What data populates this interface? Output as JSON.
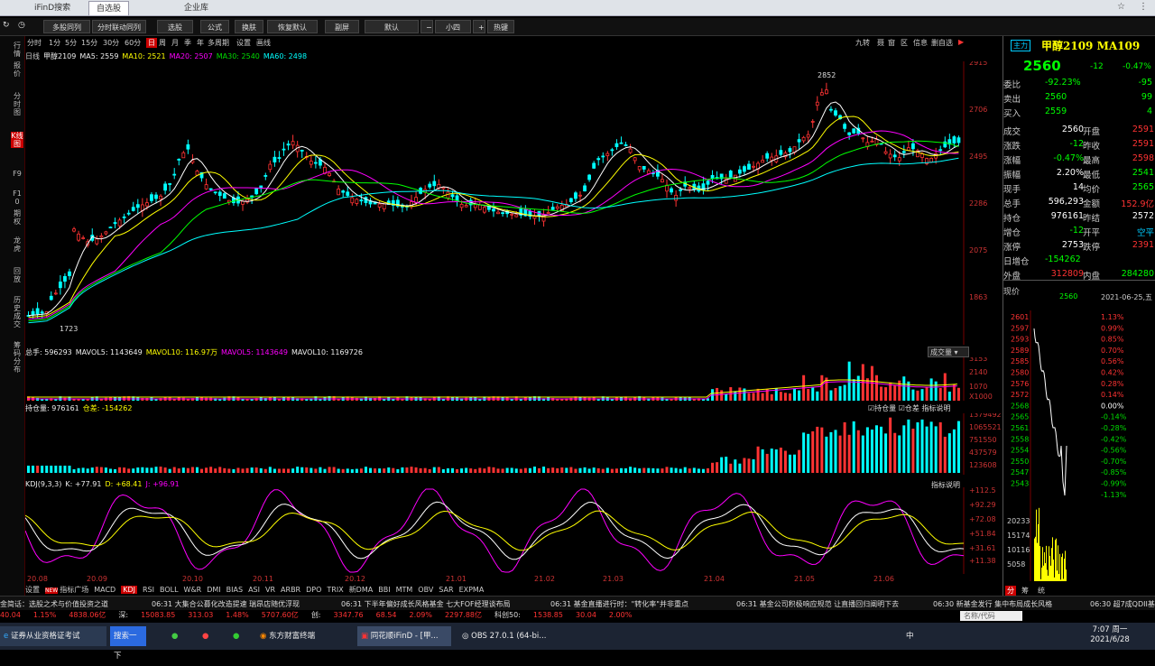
{
  "tabs": [
    "iFinD搜索",
    "自选股",
    "企业库"
  ],
  "toolbar": [
    "多股同列",
    "分时联动同列",
    "选股",
    "公式",
    "换肤",
    "恢复默认",
    "副屏",
    "默认",
    "小四",
    "热键"
  ],
  "left_nav": [
    "行情",
    "报价",
    "分时图",
    "K线图",
    "F9",
    "F10",
    "期权",
    "龙虎",
    "回放",
    "历史成交",
    "筹码分布"
  ],
  "periods": [
    "分时",
    "1分",
    "5分",
    "15分",
    "30分",
    "60分",
    "日",
    "周",
    "月",
    "季",
    "年",
    "多周期",
    "设置",
    "画线"
  ],
  "right_tools": [
    "九转",
    "聂",
    "窗",
    "区",
    "信息",
    "删自选"
  ],
  "ma_line": {
    "label": "日线",
    "name": "甲醇2109",
    "ma5": "MA5: 2559",
    "ma10": "MA10: 2521",
    "ma20": "MA20: 2507",
    "ma30": "MA30: 2540",
    "ma60": "MA60: 2498"
  },
  "price_axis": [
    "2915",
    "2706",
    "2495",
    "2286",
    "2075",
    "1863"
  ],
  "annot": {
    "high": "2852",
    "low": "1723"
  },
  "vol_line": {
    "a": "总手: 596293",
    "b": "MAVOL5: 1143649",
    "c": "MAVOL10: 116.97万",
    "d": "MAVOL5: 1143649",
    "e": "MAVOL10: 1169726"
  },
  "vol_axis": [
    "3153",
    "2140",
    "1070",
    "X1000"
  ],
  "vol_dropdown": "成交量",
  "oi_line": {
    "a": "持仓量: 976161",
    "b": "仓差: -154262"
  },
  "oi_ctrl": [
    "持仓量",
    "仓差",
    "指标说明"
  ],
  "oi_axis": [
    "1379492",
    "1065521",
    "751550",
    "437579",
    "123608"
  ],
  "kdj_line": {
    "a": "KDJ(9,3,3)",
    "b": "K: +77.91",
    "c": "D: +68.41",
    "d": "J: +96.91"
  },
  "kdj_help": "指标说明",
  "kdj_axis": [
    "+112.5",
    "+92.29",
    "+72.08",
    "+51.84",
    "+31.61",
    "+11.38"
  ],
  "dates": [
    "20.08",
    "20.09",
    "20.10",
    "20.11",
    "20.12",
    "21.01",
    "21.02",
    "21.03",
    "21.04",
    "21.05",
    "21.06"
  ],
  "indicator_tabs": [
    "设置",
    "NEW",
    "指标广场",
    "MACD",
    "KDJ",
    "RSI",
    "BOLL",
    "W&R",
    "DMI",
    "BIAS",
    "ASI",
    "VR",
    "ARBR",
    "DPO",
    "TRIX",
    "新DMA",
    "BBI",
    "MTM",
    "OBV",
    "SAR",
    "EXPMA"
  ],
  "quote": {
    "tag": "主力",
    "title": "甲醇2109 MA109",
    "price": "2560",
    "chg": "-12",
    "pct": "-0.47%",
    "rows": [
      [
        "委比",
        "-92.23%",
        "-95"
      ],
      [
        "卖出",
        "2560",
        "99"
      ],
      [
        "买入",
        "2559",
        "4"
      ]
    ],
    "rows2": [
      [
        "成交",
        "2560",
        "开盘",
        "2591"
      ],
      [
        "涨跌",
        "-12",
        "昨收",
        "2591"
      ],
      [
        "涨幅",
        "-0.47%",
        "最高",
        "2598"
      ],
      [
        "振幅",
        "2.20%",
        "最低",
        "2541"
      ],
      [
        "现手",
        "14",
        "均价",
        "2565"
      ],
      [
        "总手",
        "596,293",
        "金额",
        "152.9亿"
      ],
      [
        "持仓",
        "976161",
        "昨结",
        "2572"
      ],
      [
        "增仓",
        "-12",
        "开平",
        "空平"
      ],
      [
        "涨停",
        "2753",
        "跌停",
        "2391"
      ]
    ],
    "daily": [
      "日增仓",
      "-154262"
    ],
    "outer": [
      "外盘",
      "312809",
      "内盘",
      "284280"
    ],
    "now_label": "现价",
    "now_val": "2560",
    "now_date": "2021-06-25,五",
    "tick_prices": [
      "2601",
      "2597",
      "2593",
      "2589",
      "2585",
      "2580",
      "2576",
      "2572",
      "2568",
      "2565",
      "2561",
      "2558",
      "2554",
      "2550",
      "2547",
      "2543"
    ],
    "tick_pcts": [
      "1.13%",
      "0.99%",
      "0.85%",
      "0.70%",
      "0.56%",
      "0.42%",
      "0.28%",
      "0.14%",
      "0.00%",
      "-0.14%",
      "-0.28%",
      "-0.42%",
      "-0.56%",
      "-0.70%",
      "-0.85%",
      "-0.99%",
      "-1.13%"
    ],
    "vol_axis": [
      "20233",
      "15174",
      "10116",
      "5058"
    ],
    "bottom_tabs": [
      "分",
      "筹",
      "统"
    ]
  },
  "ticker": [
    "金简话：选股之术与价值投资之道",
    "06:31 大集合公募化改造提速 瑞昂店随优浮现",
    "06:31 下半年偏好成长风格基金 七大FOF经理谈布局",
    "06:31 基金直播进行时：\"转化率\"并非重点",
    "06:31 基金公司积极响应规范 让直播回归阐明下去",
    "06:30 新基金发行 集中布局成长风格",
    "06:30 超7成QDII基"
  ],
  "index": [
    "40.04",
    "1.15%",
    "4838.06亿",
    "深:",
    "15083.85",
    "313.03",
    "1.48%",
    "5707.60亿",
    "创:",
    "3347.76",
    "68.54",
    "2.09%",
    "2297.88亿",
    "科创50:",
    "1538.85",
    "30.04",
    "2.00%"
  ],
  "index_search": "名称/代码",
  "taskbar": {
    "apps": [
      "证券从业资格证考试",
      "搜索一下",
      "东方财富终端",
      "同花顺iFinD - [甲...",
      "OBS 27.0.1 (64-bi..."
    ],
    "time": "7:07 周一",
    "date": "2021/6/28",
    "ime": "中"
  }
}
